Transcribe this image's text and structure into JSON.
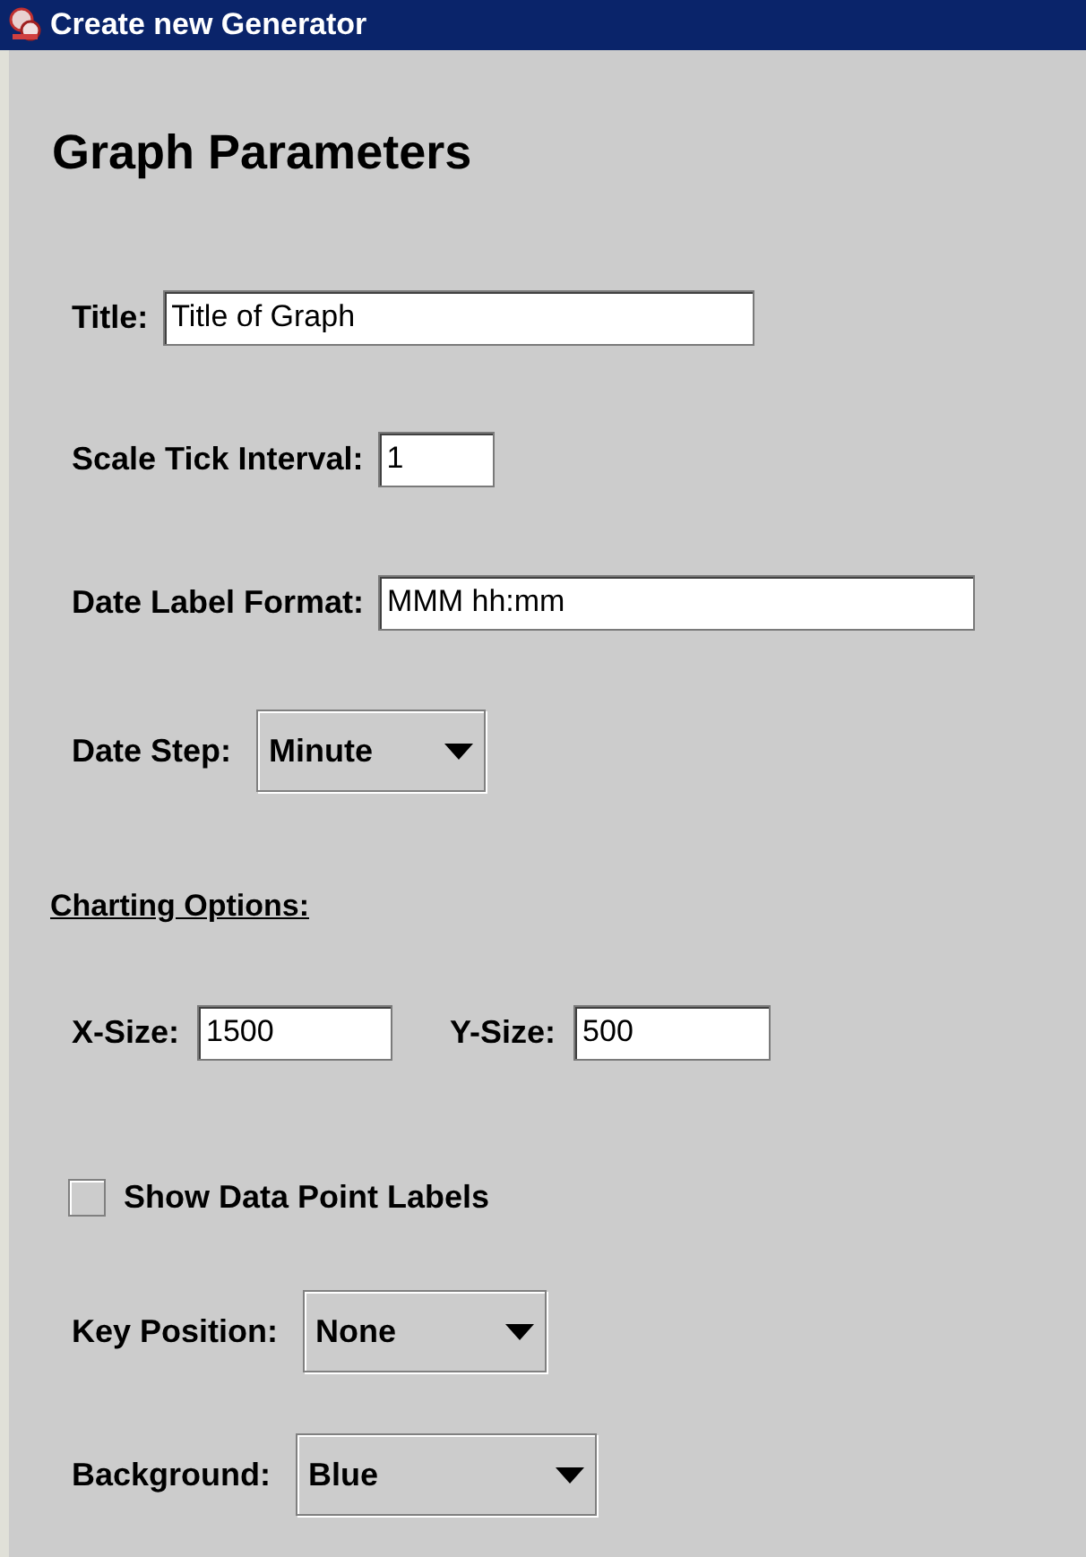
{
  "window": {
    "title": "Create new Generator"
  },
  "items": [
    {
      "kind": "heading",
      "text": "Graph Parameters"
    },
    {
      "kind": "text_field",
      "label": "Title:",
      "value": "Title of Graph"
    },
    {
      "kind": "text_field",
      "label": "Scale Tick Interval:",
      "value": "1"
    },
    {
      "kind": "text_field",
      "label": "Date Label Format:",
      "value": "MMM hh:mm"
    },
    {
      "kind": "combo",
      "label": "Date Step:",
      "value": "Minute"
    },
    {
      "kind": "section",
      "text": "Charting Options:"
    },
    {
      "kind": "pair",
      "fields": [
        {
          "label": "X-Size:",
          "value": "1500"
        },
        {
          "label": "Y-Size:",
          "value": "500"
        }
      ]
    },
    {
      "kind": "checkbox",
      "label": "Show Data Point Labels",
      "checked": false
    },
    {
      "kind": "combo",
      "label": "Key Position:",
      "value": "None"
    },
    {
      "kind": "combo",
      "label": "Background:",
      "value": "Blue"
    }
  ]
}
